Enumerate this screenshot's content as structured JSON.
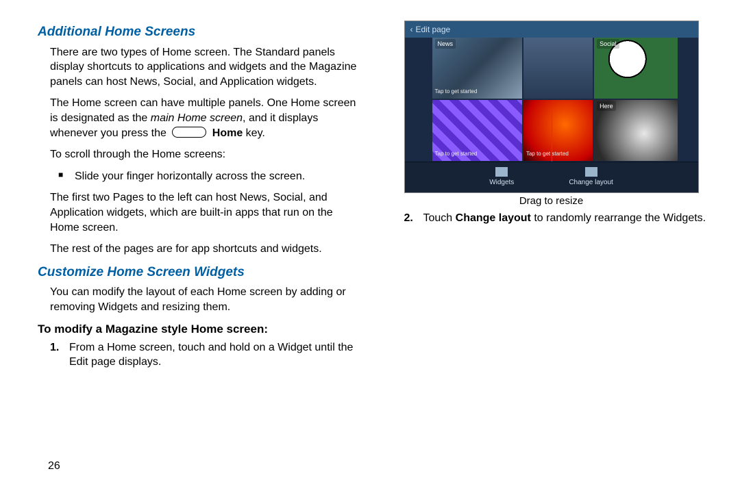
{
  "page_number": "26",
  "left": {
    "h1": "Additional Home Screens",
    "p1": "There are two types of Home screen. The Standard panels display shortcuts to applications and widgets and the Magazine panels can host News, Social, and Application widgets.",
    "p2a": "The Home screen can have multiple panels. One Home screen is designated as the ",
    "p2b_italic": "main Home screen",
    "p2c": ", and it displays whenever you press the ",
    "p2d_bold": "Home",
    "p2e": " key.",
    "p3": "To scroll through the Home screens:",
    "bullet": "Slide your finger horizontally across the screen.",
    "p4": "The first two Pages to the left can host News, Social, and Application widgets, which are built-in apps that run on the Home screen.",
    "p5": "The rest of the pages are for app shortcuts and widgets.",
    "h2": "Customize Home Screen Widgets",
    "p6": "You can modify the layout of each Home screen by adding or removing Widgets and resizing them."
  },
  "right": {
    "h1": "To modify a Magazine style Home screen:",
    "step1": "From a Home screen, touch and hold on a Widget until the Edit page displays.",
    "step2a": "Touch ",
    "step2b_bold": "Change layout",
    "step2c": " to randomly rearrange the Widgets.",
    "fig": {
      "back_label": "Edit page",
      "tiles": {
        "news": "News",
        "social": "Social",
        "here": "Here"
      },
      "tap_text": "Tap to get started",
      "bottom": {
        "widgets": "Widgets",
        "change": "Change layout"
      },
      "caption": "Drag to resize"
    }
  }
}
